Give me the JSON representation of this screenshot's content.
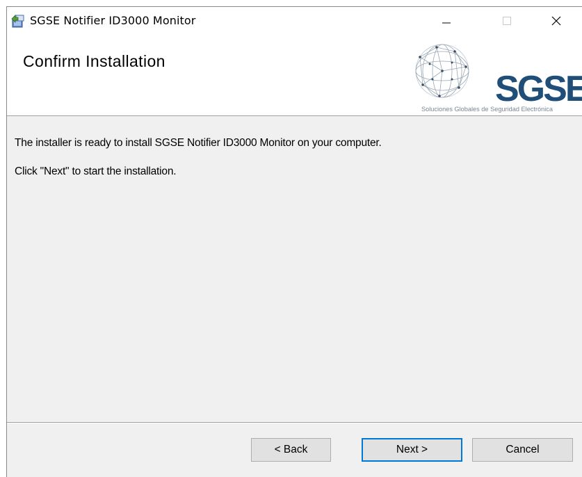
{
  "window": {
    "title": "SGSE Notifier ID3000 Monitor",
    "icon": "installer-icon"
  },
  "titlebar_buttons": {
    "minimize_icon": "minimize-icon",
    "maximize_icon": "maximize-icon",
    "close_icon": "close-icon"
  },
  "banner": {
    "title": "Confirm Installation",
    "logo": {
      "brand": "SGSE",
      "tagline": "Soluciones Globales de Seguridad Electrónica",
      "brand_color": "#1f4e79"
    }
  },
  "content": {
    "line1": "The installer is ready to install SGSE Notifier ID3000 Monitor on your computer.",
    "line2": "Click \"Next\" to start the installation."
  },
  "buttons": {
    "back": "< Back",
    "next": "Next >",
    "cancel": "Cancel",
    "focused": "next",
    "focus_color": "#0078d7"
  }
}
